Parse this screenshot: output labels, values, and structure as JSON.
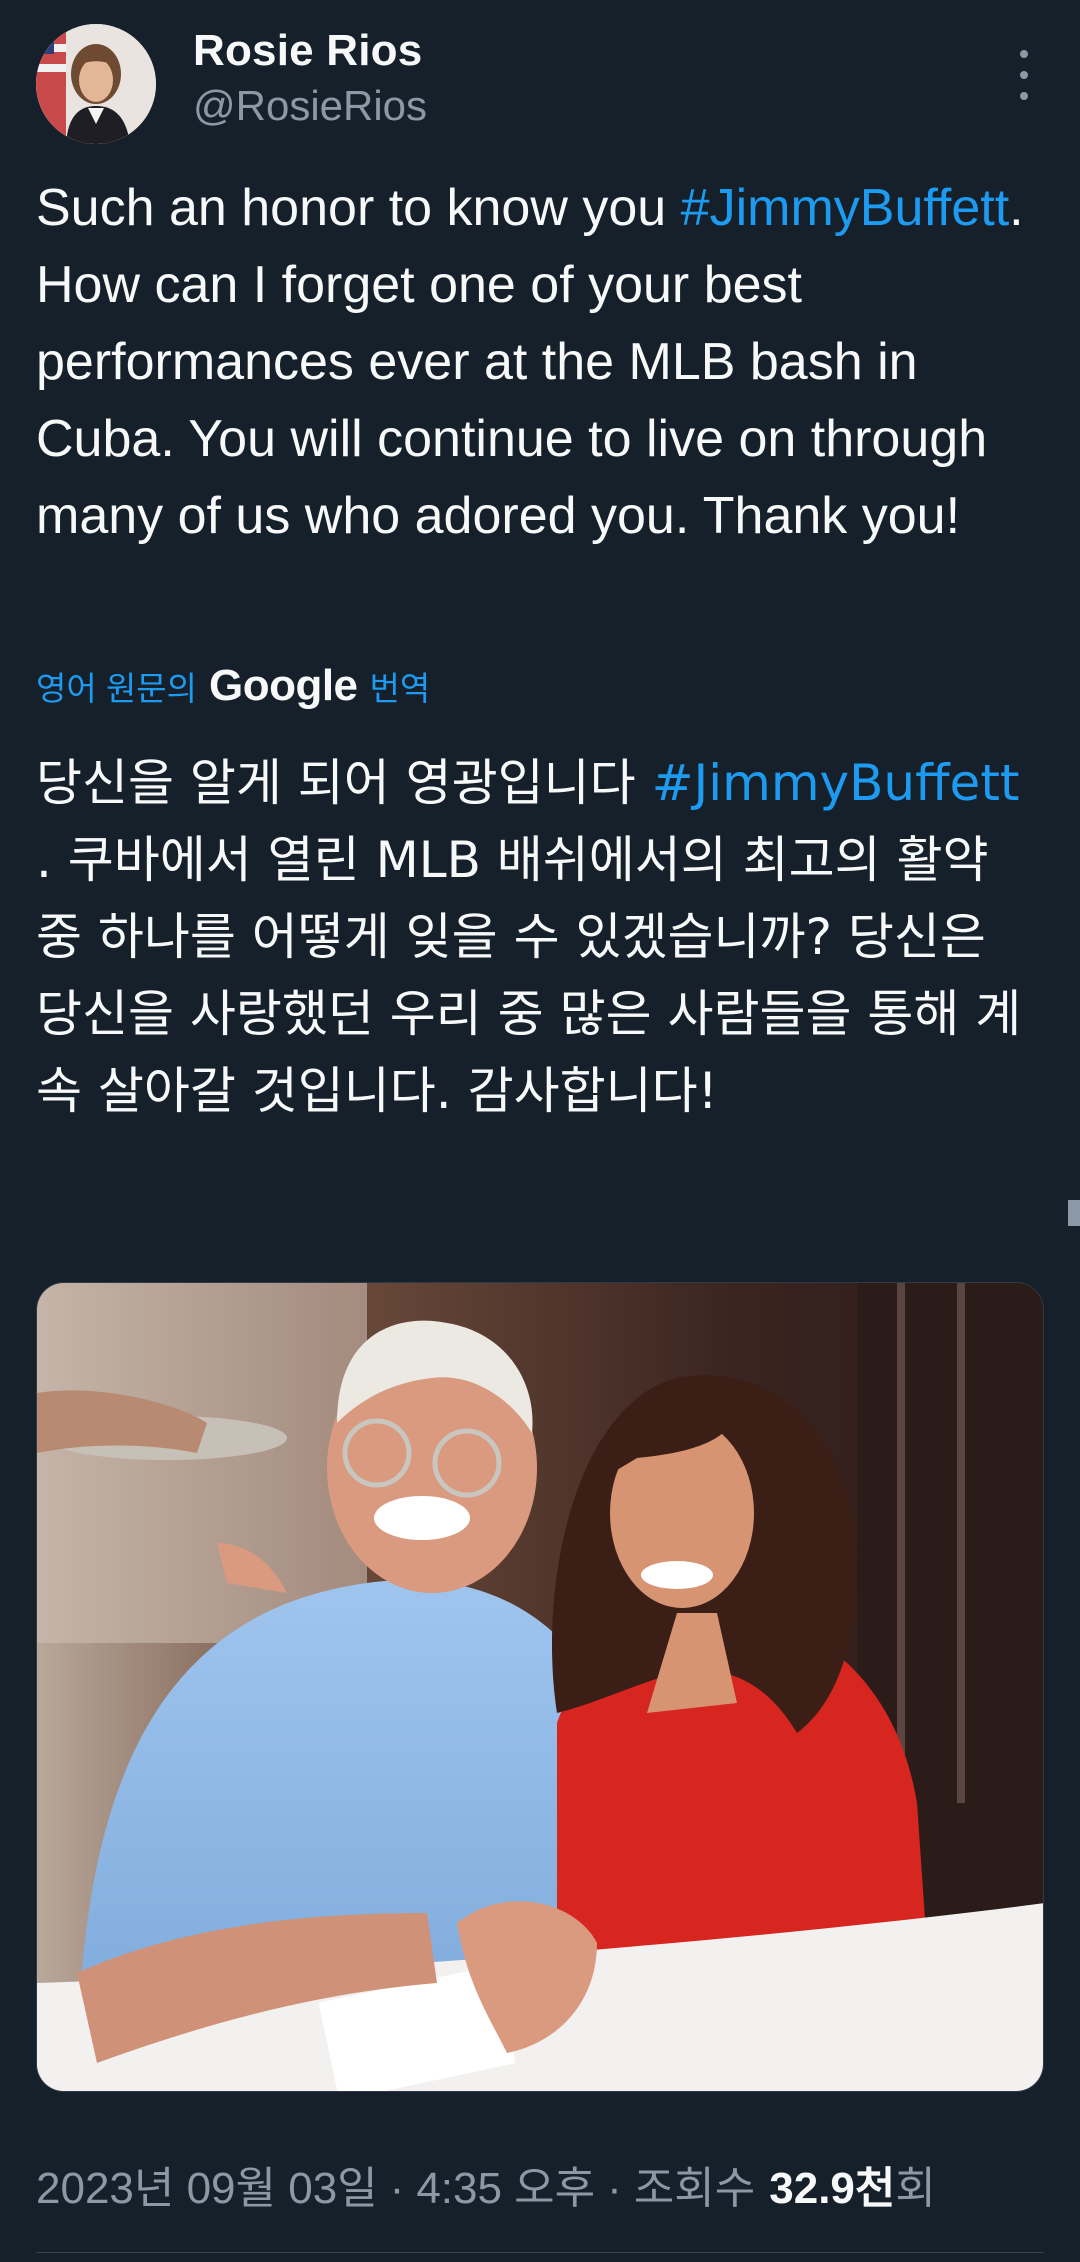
{
  "user": {
    "name": "Rosie Rios",
    "handle": "@RosieRios"
  },
  "tweet": {
    "segments": [
      {
        "text": "Such an honor to know you ",
        "type": "text"
      },
      {
        "text": "#JimmyBuffett",
        "type": "hashtag"
      },
      {
        "text": ". How can I forget one of your best performances ever at the MLB bash in Cuba. You will continue to live on through many of us who adored you. Thank you!",
        "type": "text"
      }
    ]
  },
  "translation": {
    "label_prefix": "영어 원문의",
    "provider": "Google",
    "label_suffix": "번역",
    "segments": [
      {
        "text": "당신을 알게 되어 영광입니다 ",
        "type": "text"
      },
      {
        "text": "#JimmyBuffett",
        "type": "hashtag"
      },
      {
        "text": " . 쿠바에서 열린 MLB 배쉬에서의 최고의 활약 중 하나를 어떻게 잊을 수 있겠습니까? 당신은 당신을 사랑했던 우리 중 많은 사람들을 통해 계속 살아갈 것입니다. 감사합니다!",
        "type": "text"
      }
    ]
  },
  "meta": {
    "date": "2023년 09월 03일",
    "separator": "·",
    "time": "4:35 오후",
    "views_label": "조회수",
    "views_count": "32.9천",
    "views_unit": "회"
  },
  "colors": {
    "background": "#15202b",
    "text": "#f7f9f9",
    "secondary": "#8b98a5",
    "accent": "#1d9bf0"
  },
  "icons": {
    "more": "more-vertical-icon"
  }
}
